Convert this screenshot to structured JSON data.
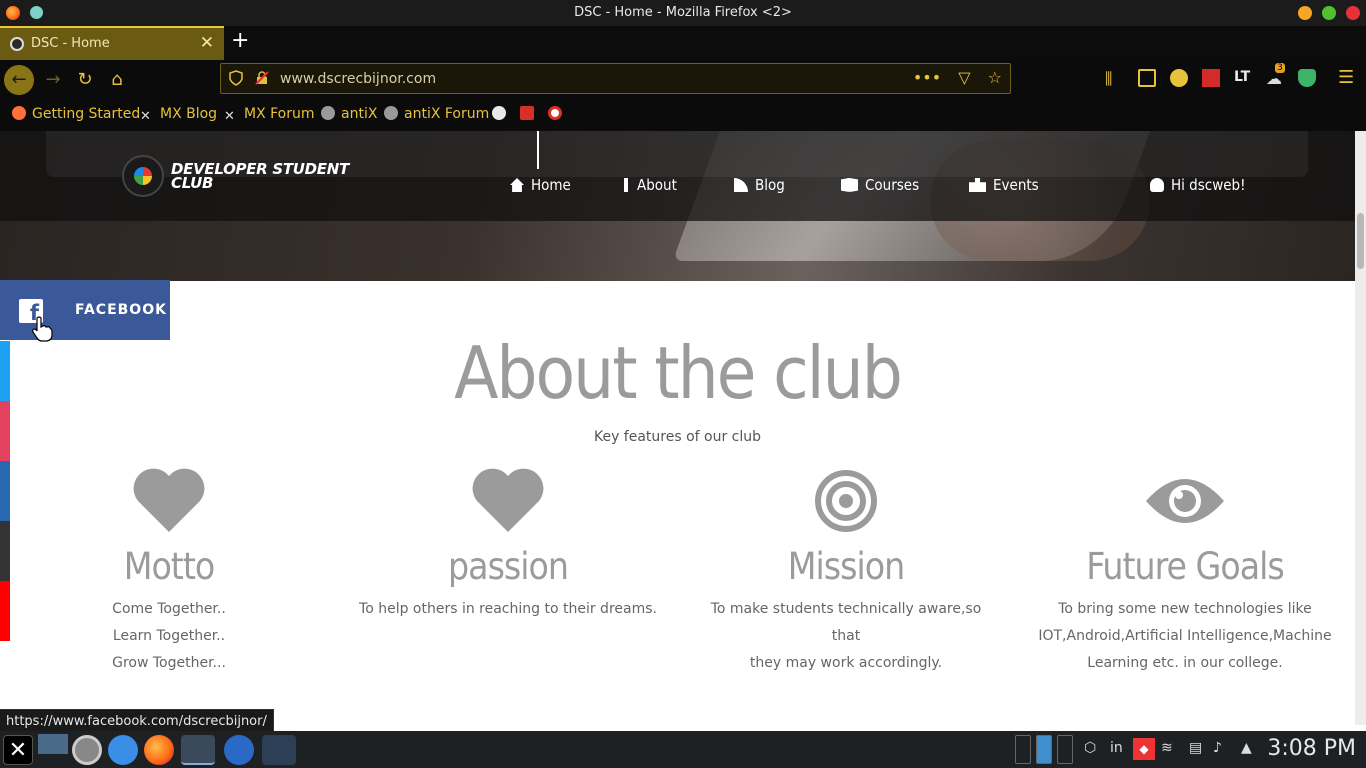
{
  "window": {
    "title": "DSC - Home - Mozilla Firefox <2>"
  },
  "tab": {
    "title": "DSC - Home"
  },
  "urlbar": {
    "url": "www.dscrecbijnor.com"
  },
  "bookmarks": [
    {
      "label": "Getting Started"
    },
    {
      "label": "MX Blog"
    },
    {
      "label": "MX Forum"
    },
    {
      "label": "antiX"
    },
    {
      "label": "antiX Forum"
    }
  ],
  "site": {
    "brand_line1": "DEVELOPER STUDENT",
    "brand_line2": "CLUB",
    "nav": [
      "Home",
      "About",
      "Blog",
      "Courses",
      "Events"
    ],
    "user_greeting": "Hi dscweb!"
  },
  "social": {
    "facebook_label": "FACEBOOK"
  },
  "about": {
    "title": "About the club",
    "subtitle": "Key features of our club",
    "features": [
      {
        "icon": "heart-icon",
        "title": "Motto",
        "lines": [
          "Come Together..",
          "Learn Together..",
          "Grow Together..."
        ]
      },
      {
        "icon": "heart-icon",
        "title": "passion",
        "lines": [
          "To help others in reaching to their dreams."
        ]
      },
      {
        "icon": "target-icon",
        "title": "Mission",
        "lines": [
          "To make students technically aware,so that",
          "they may work accordingly."
        ]
      },
      {
        "icon": "eye-icon",
        "title": "Future Goals",
        "lines": [
          "To bring some new technologies like",
          "IOT,Android,Artificial Intelligence,Machine",
          "Learning etc. in our college."
        ]
      }
    ]
  },
  "status_url": "https://www.facebook.com/dscrecbijnor/",
  "taskbar": {
    "keyboard_layout": "in",
    "clock": "3:08 PM",
    "notification_count": "3"
  },
  "colors": {
    "accent": "#e6c33a",
    "facebook": "#3b5998",
    "heading_gray": "#9b9b9b",
    "social_twitter": "#1da1f2",
    "social_instagram": "#e4405f",
    "social_linkedin": "#2867b2",
    "social_github": "#333333",
    "social_youtube": "#ff0000"
  }
}
